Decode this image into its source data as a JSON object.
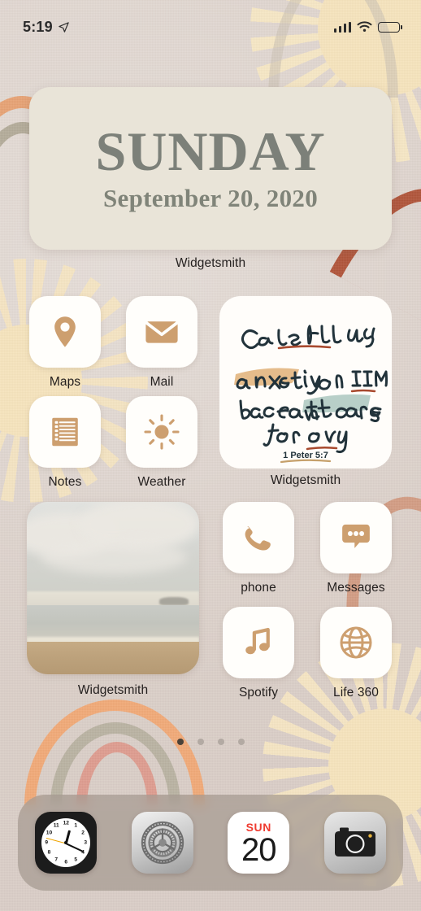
{
  "status_bar": {
    "time": "5:19",
    "location_icon": "location-arrow-icon",
    "signal_icon": "cellular-bars-icon",
    "signal_bars": 4,
    "wifi_icon": "wifi-icon",
    "battery_icon": "battery-icon",
    "battery_percent": 35
  },
  "date_widget": {
    "day_name": "SUNDAY",
    "date_text": "September 20, 2020",
    "label": "Widgetsmith",
    "background_color": "#e9e4d8",
    "text_color": "#7c8079"
  },
  "quote_widget": {
    "label": "Widgetsmith",
    "lines": [
      {
        "text": "Cast ALL your",
        "emphasis": "ALL"
      },
      {
        "text": "anxiety on HIM",
        "highlight": "anxiety",
        "emphasis": "HIM"
      },
      {
        "text": "because He cares",
        "highlight": "He cares"
      },
      {
        "text": "for you",
        "emphasis": "you"
      }
    ],
    "reference": "1 Peter 5:7",
    "full_text": "Cast ALL your anxiety on HIM because He cares for you",
    "ink_color": "#22333b",
    "highlight_orange": "#e3b681",
    "highlight_teal": "#a8c4bd",
    "underline_red": "#a8492e"
  },
  "photo_widget": {
    "label": "Widgetsmith",
    "description": "beach-photo"
  },
  "apps": {
    "accent_color": "#cd9f6f",
    "tile_color": "#fffefb",
    "row1": [
      {
        "label": "Maps",
        "icon": "map-pin-icon"
      },
      {
        "label": "Mail",
        "icon": "envelope-icon"
      }
    ],
    "row2": [
      {
        "label": "Notes",
        "icon": "notebook-icon"
      },
      {
        "label": "Weather",
        "icon": "sun-icon"
      }
    ],
    "row3": [
      {
        "label": "phone",
        "icon": "phone-handset-icon"
      },
      {
        "label": "Messages",
        "icon": "speech-bubble-icon"
      }
    ],
    "row4": [
      {
        "label": "Spotify",
        "icon": "music-note-icon"
      },
      {
        "label": "Life 360",
        "icon": "globe-icon"
      }
    ]
  },
  "page_dots": {
    "total": 4,
    "active_index": 0
  },
  "dock": {
    "items": [
      {
        "name": "Clock",
        "icon": "analog-clock-icon"
      },
      {
        "name": "Settings",
        "icon": "gears-icon"
      },
      {
        "name": "Calendar",
        "icon": "calendar-icon",
        "day_of_week": "SUN",
        "day_number": "20"
      },
      {
        "name": "Camera",
        "icon": "camera-icon"
      }
    ]
  },
  "clock_numerals": [
    "12",
    "1",
    "2",
    "3",
    "4",
    "5",
    "6",
    "7",
    "8",
    "9",
    "10",
    "11"
  ]
}
